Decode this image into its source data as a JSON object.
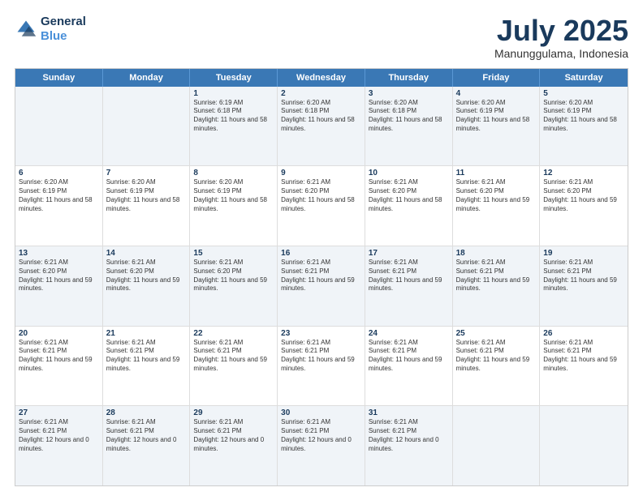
{
  "header": {
    "logo_line1": "General",
    "logo_line2": "Blue",
    "title": "July 2025",
    "subtitle": "Manunggulama, Indonesia"
  },
  "weekdays": [
    "Sunday",
    "Monday",
    "Tuesday",
    "Wednesday",
    "Thursday",
    "Friday",
    "Saturday"
  ],
  "rows": [
    [
      {
        "day": "",
        "text": ""
      },
      {
        "day": "",
        "text": ""
      },
      {
        "day": "1",
        "text": "Sunrise: 6:19 AM\nSunset: 6:18 PM\nDaylight: 11 hours and 58 minutes."
      },
      {
        "day": "2",
        "text": "Sunrise: 6:20 AM\nSunset: 6:18 PM\nDaylight: 11 hours and 58 minutes."
      },
      {
        "day": "3",
        "text": "Sunrise: 6:20 AM\nSunset: 6:18 PM\nDaylight: 11 hours and 58 minutes."
      },
      {
        "day": "4",
        "text": "Sunrise: 6:20 AM\nSunset: 6:19 PM\nDaylight: 11 hours and 58 minutes."
      },
      {
        "day": "5",
        "text": "Sunrise: 6:20 AM\nSunset: 6:19 PM\nDaylight: 11 hours and 58 minutes."
      }
    ],
    [
      {
        "day": "6",
        "text": "Sunrise: 6:20 AM\nSunset: 6:19 PM\nDaylight: 11 hours and 58 minutes."
      },
      {
        "day": "7",
        "text": "Sunrise: 6:20 AM\nSunset: 6:19 PM\nDaylight: 11 hours and 58 minutes."
      },
      {
        "day": "8",
        "text": "Sunrise: 6:20 AM\nSunset: 6:19 PM\nDaylight: 11 hours and 58 minutes."
      },
      {
        "day": "9",
        "text": "Sunrise: 6:21 AM\nSunset: 6:20 PM\nDaylight: 11 hours and 58 minutes."
      },
      {
        "day": "10",
        "text": "Sunrise: 6:21 AM\nSunset: 6:20 PM\nDaylight: 11 hours and 58 minutes."
      },
      {
        "day": "11",
        "text": "Sunrise: 6:21 AM\nSunset: 6:20 PM\nDaylight: 11 hours and 59 minutes."
      },
      {
        "day": "12",
        "text": "Sunrise: 6:21 AM\nSunset: 6:20 PM\nDaylight: 11 hours and 59 minutes."
      }
    ],
    [
      {
        "day": "13",
        "text": "Sunrise: 6:21 AM\nSunset: 6:20 PM\nDaylight: 11 hours and 59 minutes."
      },
      {
        "day": "14",
        "text": "Sunrise: 6:21 AM\nSunset: 6:20 PM\nDaylight: 11 hours and 59 minutes."
      },
      {
        "day": "15",
        "text": "Sunrise: 6:21 AM\nSunset: 6:20 PM\nDaylight: 11 hours and 59 minutes."
      },
      {
        "day": "16",
        "text": "Sunrise: 6:21 AM\nSunset: 6:21 PM\nDaylight: 11 hours and 59 minutes."
      },
      {
        "day": "17",
        "text": "Sunrise: 6:21 AM\nSunset: 6:21 PM\nDaylight: 11 hours and 59 minutes."
      },
      {
        "day": "18",
        "text": "Sunrise: 6:21 AM\nSunset: 6:21 PM\nDaylight: 11 hours and 59 minutes."
      },
      {
        "day": "19",
        "text": "Sunrise: 6:21 AM\nSunset: 6:21 PM\nDaylight: 11 hours and 59 minutes."
      }
    ],
    [
      {
        "day": "20",
        "text": "Sunrise: 6:21 AM\nSunset: 6:21 PM\nDaylight: 11 hours and 59 minutes."
      },
      {
        "day": "21",
        "text": "Sunrise: 6:21 AM\nSunset: 6:21 PM\nDaylight: 11 hours and 59 minutes."
      },
      {
        "day": "22",
        "text": "Sunrise: 6:21 AM\nSunset: 6:21 PM\nDaylight: 11 hours and 59 minutes."
      },
      {
        "day": "23",
        "text": "Sunrise: 6:21 AM\nSunset: 6:21 PM\nDaylight: 11 hours and 59 minutes."
      },
      {
        "day": "24",
        "text": "Sunrise: 6:21 AM\nSunset: 6:21 PM\nDaylight: 11 hours and 59 minutes."
      },
      {
        "day": "25",
        "text": "Sunrise: 6:21 AM\nSunset: 6:21 PM\nDaylight: 11 hours and 59 minutes."
      },
      {
        "day": "26",
        "text": "Sunrise: 6:21 AM\nSunset: 6:21 PM\nDaylight: 11 hours and 59 minutes."
      }
    ],
    [
      {
        "day": "27",
        "text": "Sunrise: 6:21 AM\nSunset: 6:21 PM\nDaylight: 12 hours and 0 minutes."
      },
      {
        "day": "28",
        "text": "Sunrise: 6:21 AM\nSunset: 6:21 PM\nDaylight: 12 hours and 0 minutes."
      },
      {
        "day": "29",
        "text": "Sunrise: 6:21 AM\nSunset: 6:21 PM\nDaylight: 12 hours and 0 minutes."
      },
      {
        "day": "30",
        "text": "Sunrise: 6:21 AM\nSunset: 6:21 PM\nDaylight: 12 hours and 0 minutes."
      },
      {
        "day": "31",
        "text": "Sunrise: 6:21 AM\nSunset: 6:21 PM\nDaylight: 12 hours and 0 minutes."
      },
      {
        "day": "",
        "text": ""
      },
      {
        "day": "",
        "text": ""
      }
    ]
  ],
  "alt_rows": [
    0,
    2,
    4
  ]
}
